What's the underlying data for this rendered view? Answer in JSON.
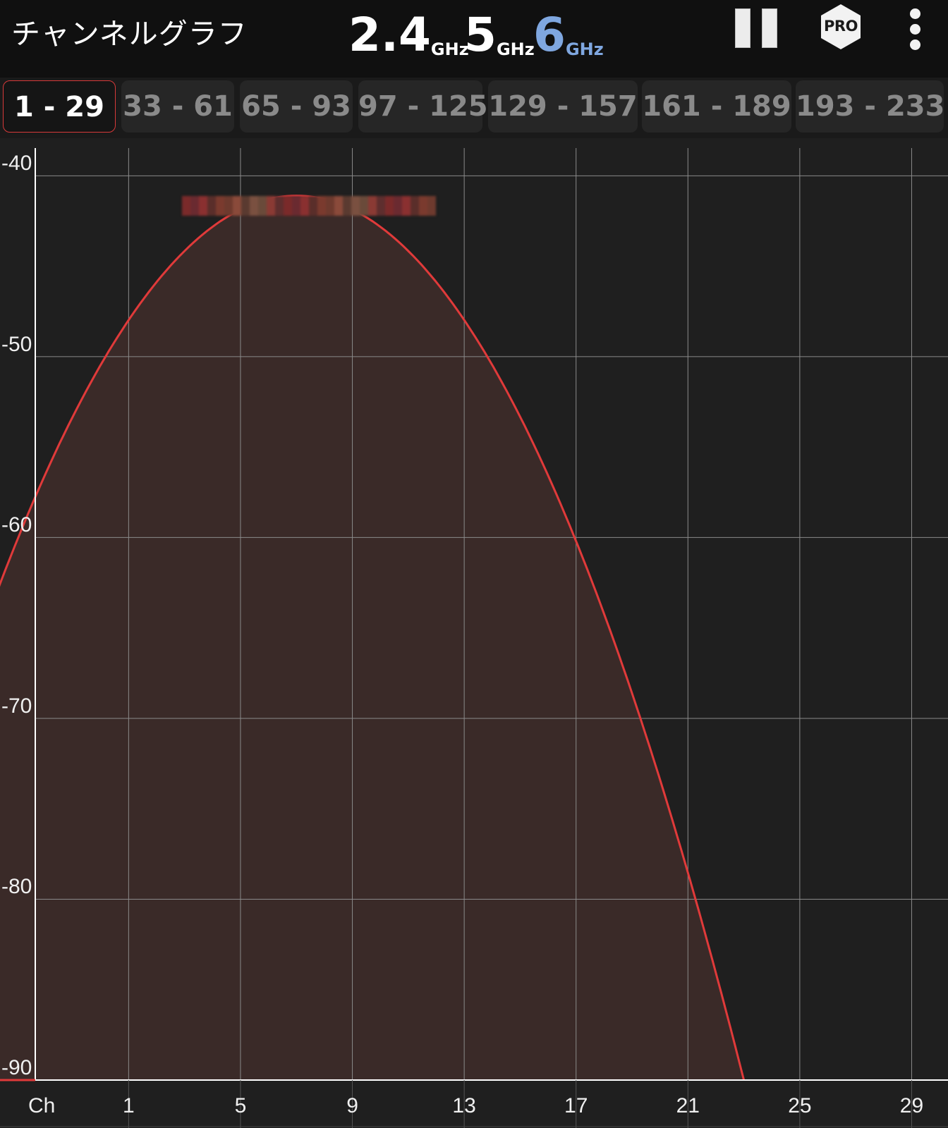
{
  "header": {
    "title": "チャンネルグラフ",
    "bands": [
      {
        "value": "2.4",
        "unit": "GHz",
        "color": "#ffffff"
      },
      {
        "value": "5",
        "unit": "GHz",
        "color": "#ffffff"
      },
      {
        "value": "6",
        "unit": "GHz",
        "color": "#7fa7e0"
      }
    ],
    "pro_label": "PRO"
  },
  "tabs": [
    "1 - 29",
    "33 - 61",
    "65 - 93",
    "97 - 125",
    "129 - 157",
    "161 - 189",
    "193 - 233"
  ],
  "active_tab": 0,
  "chart_data": {
    "type": "area",
    "x_ticks": [
      1,
      5,
      9,
      13,
      17,
      21,
      25,
      29
    ],
    "x_tick_labels": [
      "1",
      "5",
      "9",
      "13",
      "17",
      "21",
      "25",
      "29"
    ],
    "x_axis_label": "Ch",
    "y_ticks": [
      -40,
      -50,
      -60,
      -70,
      -80,
      -90
    ],
    "y_tick_labels": [
      "-40",
      "-50",
      "-60",
      "-70",
      "-80",
      "-90"
    ],
    "xlim": [
      -3.6,
      30.3
    ],
    "ylim": [
      -90,
      -38.7
    ],
    "grid": true,
    "series": [
      {
        "center_channel": 7,
        "width_mhz": 160,
        "peak_dbm": -41.1,
        "edge_dbm": -90,
        "x_start": -9,
        "x_end": 23,
        "color": "#e03a3a",
        "fill": "#3a2a28"
      }
    ]
  }
}
